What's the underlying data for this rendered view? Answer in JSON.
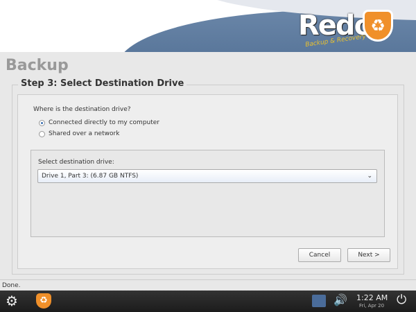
{
  "logo": {
    "name": "Redo",
    "tagline": "Backup & Recovery"
  },
  "page": {
    "title": "Backup",
    "step": "Step 3: Select Destination Drive"
  },
  "location": {
    "question": "Where is the destination drive?",
    "options": [
      {
        "label": "Connected directly to my computer",
        "selected": true
      },
      {
        "label": "Shared over a network",
        "selected": false
      }
    ]
  },
  "drive": {
    "label": "Select destination drive:",
    "value": "Drive 1, Part 3: (6.87 GB NTFS)"
  },
  "buttons": {
    "cancel": "Cancel",
    "next": "Next >"
  },
  "status": "Done.",
  "taskbar": {
    "time": "1:22 AM",
    "date": "Fri, Apr 20"
  }
}
